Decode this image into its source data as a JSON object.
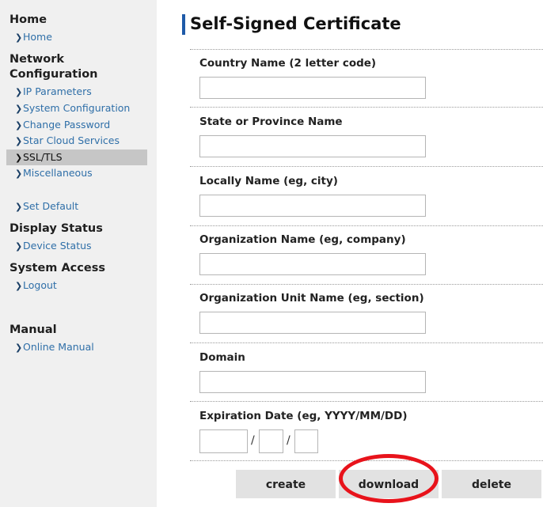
{
  "sidebar": {
    "sections": {
      "home": "Home",
      "network": "Network Configuration",
      "display": "Display Status",
      "system": "System Access",
      "manual": "Manual"
    },
    "items": {
      "home": "Home",
      "ip": "IP Parameters",
      "sysconf": "System Configuration",
      "password": "Change Password",
      "cloud": "Star Cloud Services",
      "ssl": "SSL/TLS",
      "misc": "Miscellaneous",
      "setdefault": "Set Default",
      "device": "Device Status",
      "logout": "Logout",
      "online": "Online Manual"
    },
    "active_item": "SSL/TLS"
  },
  "main": {
    "title": "Self-Signed Certificate",
    "fields": {
      "country": {
        "label": "Country Name (2 letter code)",
        "value": ""
      },
      "state": {
        "label": "State or Province Name",
        "value": ""
      },
      "locality": {
        "label": "Locally Name (eg, city)",
        "value": ""
      },
      "organization": {
        "label": "Organization Name (eg, company)",
        "value": ""
      },
      "unit": {
        "label": "Organization Unit Name (eg, section)",
        "value": ""
      },
      "domain": {
        "label": "Domain",
        "value": ""
      },
      "expiration": {
        "label": "Expiration Date (eg, YYYY/MM/DD)",
        "separator": "/",
        "year": "",
        "month": "",
        "day": ""
      }
    },
    "buttons": {
      "create": "create",
      "download": "download",
      "delete": "delete"
    }
  },
  "annotation": {
    "color": "#e8131b",
    "target": "download"
  },
  "colors": {
    "accent": "#1e5aa8",
    "link": "#2f6fa8",
    "sidebar_bg": "#f0f0f0",
    "active_bg": "#c6c6c6",
    "button_bg": "#e2e2e2"
  }
}
